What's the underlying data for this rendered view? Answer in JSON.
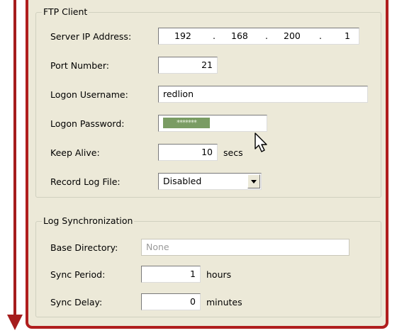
{
  "ftp": {
    "title": "FTP Client",
    "server_ip_label": "Server IP Address:",
    "ip": [
      "192",
      ".",
      "168",
      ".",
      "200",
      ".",
      "1"
    ],
    "port_label": "Port Number:",
    "port_value": "21",
    "username_label": "Logon Username:",
    "username_value": "redlion",
    "password_label": "Logon Password:",
    "password_mask": "*******",
    "keepalive_label": "Keep Alive:",
    "keepalive_value": "10",
    "keepalive_unit": "secs",
    "recordlog_label": "Record Log File:",
    "recordlog_value": "Disabled"
  },
  "logsync": {
    "title": "Log Synchronization",
    "base_dir_label": "Base Directory:",
    "base_dir_placeholder": "None",
    "sync_period_label": "Sync Period:",
    "sync_period_value": "1",
    "sync_period_unit": "hours",
    "sync_delay_label": "Sync Delay:",
    "sync_delay_value": "0",
    "sync_delay_unit": "minutes"
  },
  "colors": {
    "accent_red": "#b01e1e",
    "panel_bg": "#ece9d8",
    "password_fill": "#7a9c63"
  }
}
